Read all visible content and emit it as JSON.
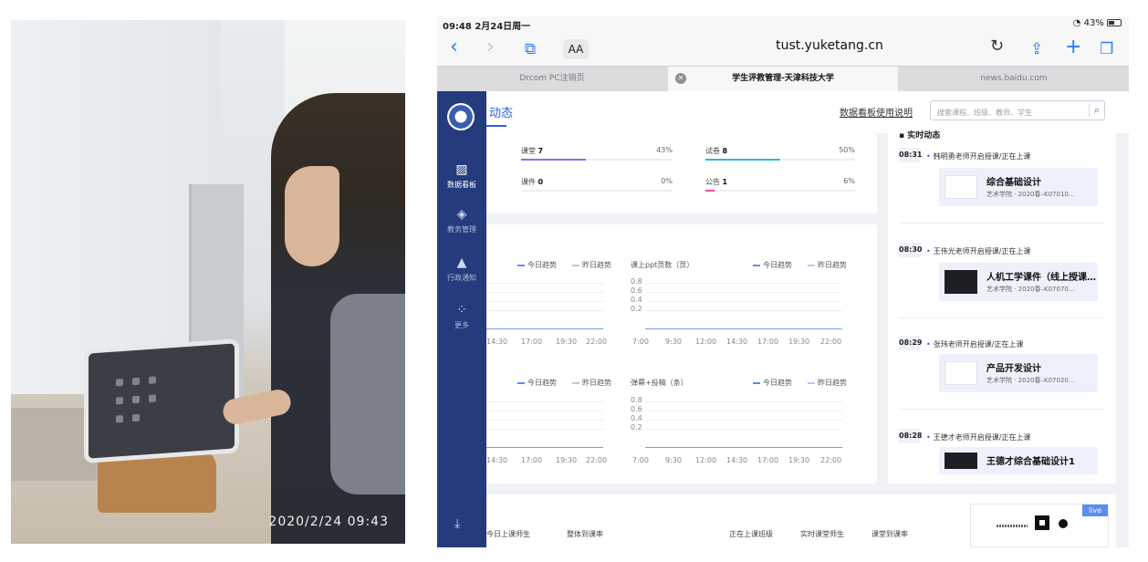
{
  "photo": {
    "timestamp": "2020/2/24  09:43"
  },
  "status_bar": {
    "time_date": "09:48  2月24日周一",
    "battery": "43%"
  },
  "browser": {
    "reader_label": "AA",
    "url": "tust.yuketang.cn",
    "tabs": [
      {
        "label": "Drcom PC注销页"
      },
      {
        "label": "学生评教管理-天津科技大学"
      },
      {
        "label": "news.baidu.com"
      }
    ]
  },
  "sidebar": {
    "items": [
      {
        "label": "数据看板",
        "icon": "chart-icon"
      },
      {
        "label": "教务管理",
        "icon": "layers-icon"
      },
      {
        "label": "行政通知",
        "icon": "bell-icon"
      },
      {
        "label": "更多",
        "icon": "grid-icon"
      }
    ]
  },
  "header": {
    "title": "动态",
    "guide_link": "数据看板使用说明",
    "search_placeholder": "搜索课程、班级、教师、学生"
  },
  "stats": [
    {
      "label": "课堂",
      "value": "7",
      "pct": "43%",
      "fill": 0.43,
      "color": "#8e6cf2"
    },
    {
      "label": "试卷",
      "value": "8",
      "pct": "50%",
      "fill": 0.5,
      "color": "#2bb8d9"
    },
    {
      "label": "课件",
      "value": "0",
      "pct": "0%",
      "fill": 0,
      "color": "#5b8cf5"
    },
    {
      "label": "公告",
      "value": "1",
      "pct": "6%",
      "fill": 0.06,
      "color": "#ef4f9a"
    }
  ],
  "charts": {
    "legend_today": "今日趋势",
    "legend_yesterday": "昨日趋势",
    "ppt_title": "课上ppt页数（页）",
    "danmu_title": "弹幕+投稿（条）",
    "y_ticks": [
      "0.8",
      "0.6",
      "0.4",
      "0.2"
    ],
    "x_ticks_left": [
      "14:30",
      "17:00",
      "19:30",
      "22:00"
    ],
    "x_ticks_right": [
      "7:00",
      "9:30",
      "12:00",
      "14:30",
      "17:00",
      "19:30",
      "22:00"
    ]
  },
  "realtime": {
    "title": "实时动态",
    "items": [
      {
        "time": "08:31",
        "text": "韩明勇老师开启授课/正在上课",
        "course": "综合基础设计",
        "sub": "艺术学院 · 2020春–K07010…"
      },
      {
        "time": "08:30",
        "text": "王伟光老师开启授课/正在上课",
        "course": "人机工学课件（线上授课…",
        "sub": "艺术学院 · 2020春–K07070…"
      },
      {
        "time": "08:29",
        "text": "张玮老师开启授课/正在上课",
        "course": "产品开发设计",
        "sub": "艺术学院 · 2020春–K07020…"
      },
      {
        "time": "08:28",
        "text": "王德才老师开启授课/正在上课",
        "course": "王德才综合基础设计1",
        "sub": ""
      }
    ]
  },
  "bottom": {
    "labels": [
      "今日上课师生",
      "整体到课率",
      "正在上课班级",
      "实时课堂师生",
      "课堂到课率"
    ],
    "live_tag": "live"
  }
}
